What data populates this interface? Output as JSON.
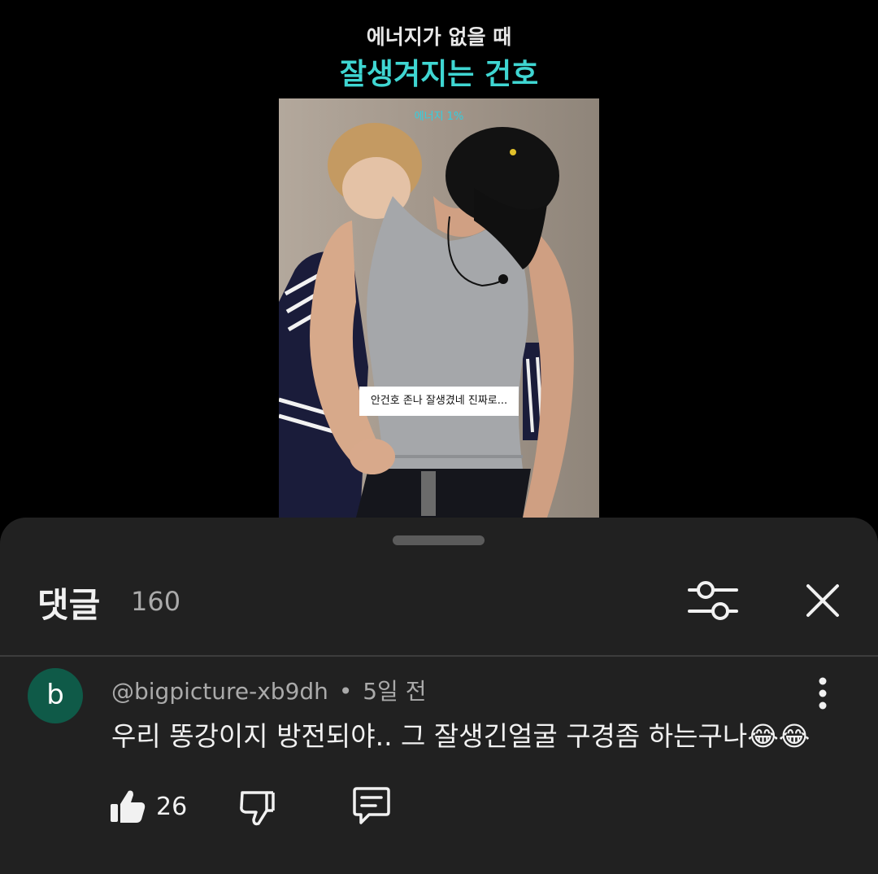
{
  "video": {
    "title_line1": "에너지가 없을 때",
    "title_line2": "잘생겨지는 건호",
    "energy_label": "에너지 1%",
    "subtitle": "안건호 존나 잘생겼네 진짜로..."
  },
  "comments_panel": {
    "title": "댓글",
    "count": "160",
    "icons": {
      "filter": "filter-sliders-icon",
      "close": "close-icon"
    }
  },
  "comments": [
    {
      "avatar_letter": "b",
      "avatar_color": "#0f5a48",
      "author": "@bigpicture-xb9dh",
      "separator": "•",
      "time": "5일 전",
      "text": "우리 똥강이지 방전되야.. 그 잘생긴얼굴 구경좀 하는구나😂😂",
      "likes": "26",
      "icons": {
        "like": "thumbs-up-icon",
        "dislike": "thumbs-down-icon",
        "reply": "reply-icon",
        "more": "more-vertical-icon"
      }
    }
  ],
  "colors": {
    "accent_title": "#3fd6d2",
    "energy_label": "#33cfe0",
    "sheet_background": "#212121"
  }
}
